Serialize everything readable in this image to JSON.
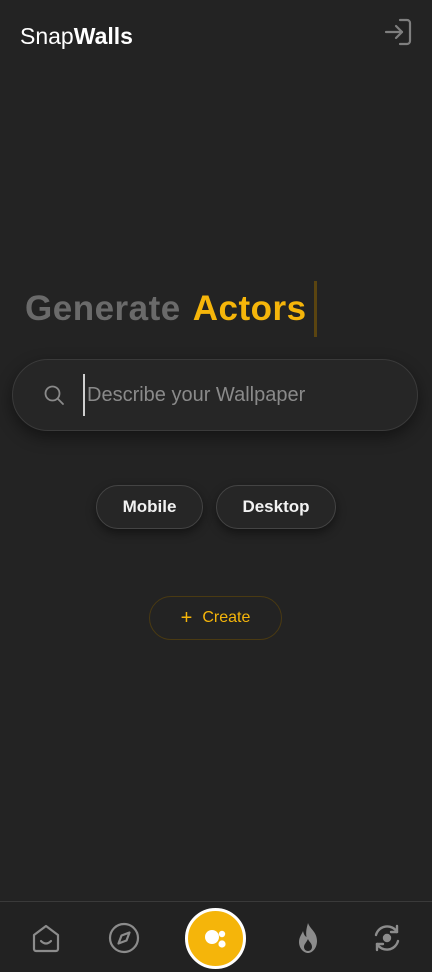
{
  "header": {
    "logo_light": "Snap",
    "logo_bold": "Walls",
    "login_icon": "login-icon"
  },
  "hero": {
    "static_word": "Generate",
    "dynamic_word": "Actors"
  },
  "search": {
    "placeholder": "Describe your Wallpaper",
    "value": "",
    "icon": "search-icon"
  },
  "device_options": [
    {
      "label": "Mobile"
    },
    {
      "label": "Desktop"
    }
  ],
  "create": {
    "label": "Create",
    "icon": "plus-icon"
  },
  "bottom_nav": {
    "items": [
      {
        "icon": "home-icon",
        "active": false
      },
      {
        "icon": "compass-icon",
        "active": false
      },
      {
        "icon": "generate-icon",
        "active": true
      },
      {
        "icon": "fire-icon",
        "active": false
      },
      {
        "icon": "refresh-icon",
        "active": false
      }
    ]
  },
  "colors": {
    "background": "#232323",
    "accent": "#f5b50a",
    "muted_text": "#6a6a6a",
    "icon_gray": "#8c8c8c"
  }
}
